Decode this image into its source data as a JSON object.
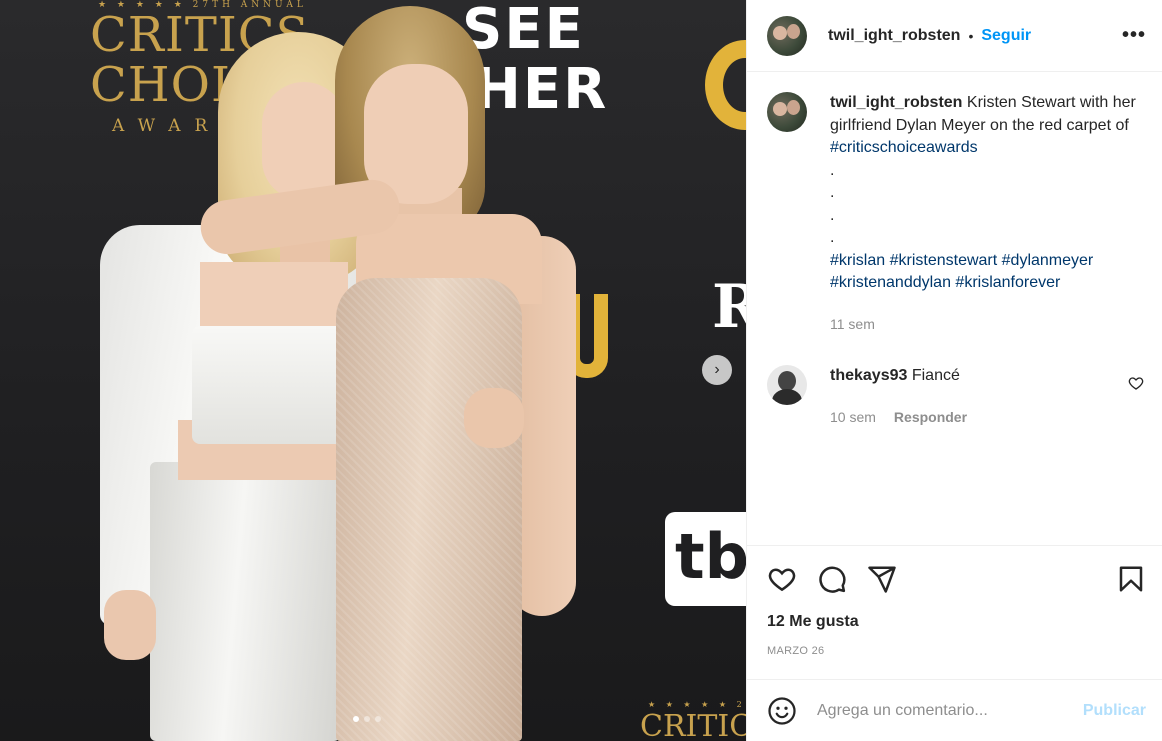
{
  "photo": {
    "bg_logo_top": {
      "stars": "★ ★ ★ ★ ★ 27TH ANNUAL",
      "line1": "CRITICS",
      "line2": "CHOICE",
      "line3": "AWARDS"
    },
    "bg_see_her": {
      "line1": "SEE",
      "line2": "HER"
    },
    "bg_rw": "R",
    "bg_tbs": "tb",
    "bg_logo_bottom": {
      "stars": "★ ★ ★ ★ ★ 2",
      "line1": "CRITIC"
    },
    "carousel_next_icon": "chevron-right-icon",
    "carousel": {
      "total": 3,
      "active": 1
    }
  },
  "header": {
    "username": "twil_ight_robsten",
    "separator": "•",
    "follow_label": "Seguir",
    "more_icon": "more-horizontal-icon"
  },
  "caption": {
    "username": "twil_ight_robsten",
    "text": "Kristen Stewart with her girlfriend Dylan Meyer on the red carpet of",
    "hashtag_inline": "#criticschoiceawards",
    "dot_lines": [
      ".",
      ".",
      ".",
      "."
    ],
    "hashtags": [
      "#krislan",
      "#kristenstewart",
      "#dylanmeyer",
      "#kristenanddylan",
      "#krislanforever"
    ],
    "time": "11 sem"
  },
  "comment": {
    "username": "thekays93",
    "text": "Fiancé",
    "time": "10 sem",
    "reply_label": "Responder",
    "like_icon": "heart-icon"
  },
  "actions": {
    "like_icon": "heart-icon",
    "comment_icon": "comment-icon",
    "share_icon": "send-icon",
    "save_icon": "bookmark-icon"
  },
  "likes_text": "12 Me gusta",
  "date_text": "MARZO 26",
  "add_comment": {
    "emoji_icon": "emoji-icon",
    "placeholder": "Agrega un comentario...",
    "publish_label": "Publicar"
  },
  "colors": {
    "accent": "#0095f6",
    "hashtag": "#00376b",
    "muted": "#8e8e8e",
    "publish_disabled": "#b2dffc",
    "award_gold": "#c8a24e"
  }
}
